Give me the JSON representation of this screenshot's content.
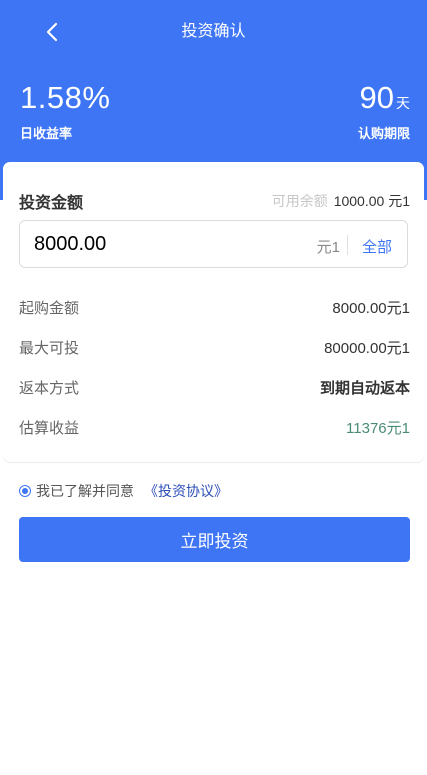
{
  "nav": {
    "title": "投资确认"
  },
  "summary": {
    "rate_value": "1.58%",
    "rate_label": "日收益率",
    "term_value": "90",
    "term_unit": "天",
    "term_label": "认购期限"
  },
  "amount": {
    "title": "投资金额",
    "balance_label": "可用余额",
    "balance_value": "1000.00 元1",
    "input_value": "8000.00",
    "unit": "元1",
    "all_label": "全部"
  },
  "details": [
    {
      "label": "起购金额",
      "value": "8000.00元1"
    },
    {
      "label": "最大可投",
      "value": "80000.00元1"
    },
    {
      "label": "返本方式",
      "value": "到期自动返本"
    },
    {
      "label": "估算收益",
      "value": "11376元1"
    }
  ],
  "agreement": {
    "text": "我已了解并同意",
    "link": "《投资协议》",
    "checked": true
  },
  "submit_label": "立即投资",
  "colors": {
    "primary": "#3d75f4",
    "profit": "#4a8c73",
    "link": "#2d4fb8"
  }
}
